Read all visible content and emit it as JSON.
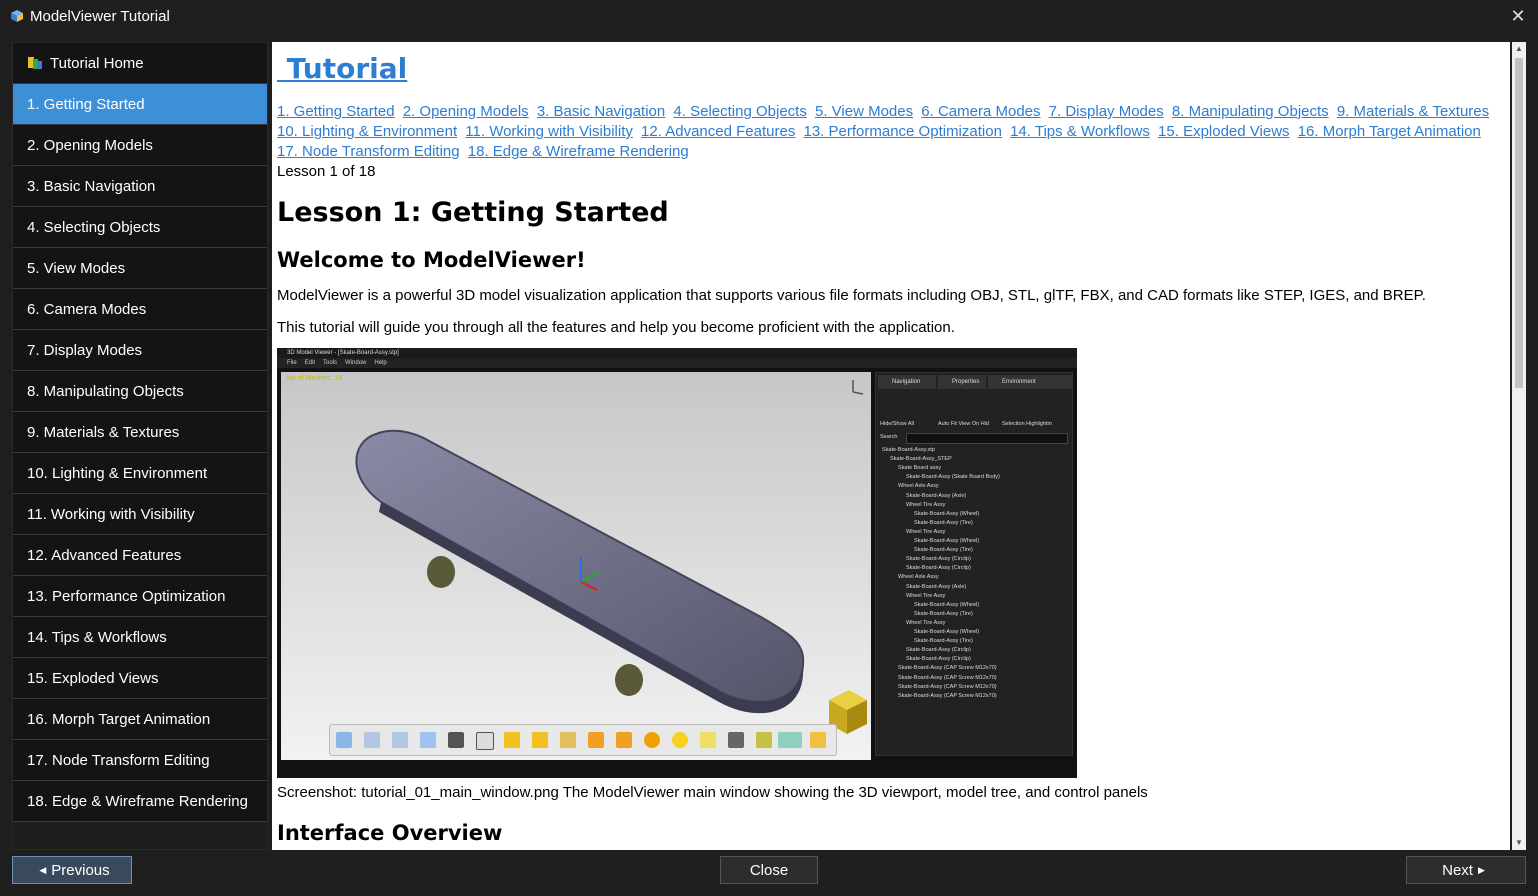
{
  "window": {
    "title": "ModelViewer Tutorial"
  },
  "sidebar": {
    "home_label": "Tutorial Home",
    "items": [
      {
        "label": "1. Getting Started",
        "active": true
      },
      {
        "label": "2. Opening Models"
      },
      {
        "label": "3. Basic Navigation"
      },
      {
        "label": "4. Selecting Objects"
      },
      {
        "label": "5. View Modes"
      },
      {
        "label": "6. Camera Modes"
      },
      {
        "label": "7. Display Modes"
      },
      {
        "label": "8. Manipulating Objects"
      },
      {
        "label": "9. Materials & Textures"
      },
      {
        "label": "10. Lighting & Environment"
      },
      {
        "label": "11. Working with Visibility"
      },
      {
        "label": "12. Advanced Features"
      },
      {
        "label": "13. Performance Optimization"
      },
      {
        "label": "14. Tips & Workflows"
      },
      {
        "label": "15. Exploded Views"
      },
      {
        "label": "16. Morph Target Animation"
      },
      {
        "label": "17. Node Transform Editing"
      },
      {
        "label": "18. Edge & Wireframe Rendering"
      }
    ]
  },
  "content": {
    "heading": "Tutorial",
    "links": [
      "1. Getting Started",
      "2. Opening Models",
      "3. Basic Navigation",
      "4. Selecting Objects",
      "5. View Modes",
      "6. Camera Modes",
      "7. Display Modes",
      "8. Manipulating Objects",
      "9. Materials & Textures",
      "10. Lighting & Environment",
      "11. Working with Visibility",
      "12. Advanced Features",
      "13. Performance Optimization",
      "14. Tips & Workflows",
      "15. Exploded Views",
      "16. Morph Target Animation",
      "17. Node Transform Editing",
      "18. Edge & Wireframe Rendering"
    ],
    "lesson_count": "Lesson 1 of 18",
    "lesson_title": "Lesson 1: Getting Started",
    "section_title": "Welcome to ModelViewer!",
    "para1": "ModelViewer is a powerful 3D model visualization application that supports various file formats including OBJ, STL, glTF, FBX, and CAD formats like STEP, IGES, and BREP.",
    "para2": "This tutorial will guide you through all the features and help you become proficient with the application.",
    "screenshot": {
      "title": "3D Model Viewer - [Skate-Board-Assy.stp]",
      "menu": [
        "File",
        "Edit",
        "Tools",
        "Window",
        "Help"
      ],
      "meshes": "No of Meshes: 19",
      "tabs": [
        "Navigation",
        "Properties",
        "Environment"
      ],
      "checks": [
        "Hide/Show All",
        "Auto Fit View On Hid",
        "Selection Highlightin"
      ],
      "search_label": "Search",
      "tree": [
        {
          "indent": 0,
          "text": "Skate-Board-Assy.stp"
        },
        {
          "indent": 1,
          "text": "Skate-Board-Assy_STEP"
        },
        {
          "indent": 2,
          "text": "Skate Board assy"
        },
        {
          "indent": 3,
          "text": "Skate-Board-Assy (Skate Board Body)"
        },
        {
          "indent": 2,
          "text": "Wheel Axle Assy"
        },
        {
          "indent": 3,
          "text": "Skate-Board-Assy (Axle)"
        },
        {
          "indent": 3,
          "text": "Wheel Tire Assy"
        },
        {
          "indent": 4,
          "text": "Skate-Board-Assy (Wheel)"
        },
        {
          "indent": 4,
          "text": "Skate-Board-Assy (Tire)"
        },
        {
          "indent": 3,
          "text": "Wheel Tire Assy"
        },
        {
          "indent": 4,
          "text": "Skate-Board-Assy (Wheel)"
        },
        {
          "indent": 4,
          "text": "Skate-Board-Assy (Tire)"
        },
        {
          "indent": 3,
          "text": "Skate-Board-Assy (Circlip)"
        },
        {
          "indent": 3,
          "text": "Skate-Board-Assy (Circlip)"
        },
        {
          "indent": 2,
          "text": "Wheel Axle Assy"
        },
        {
          "indent": 3,
          "text": "Skate-Board-Assy (Axle)"
        },
        {
          "indent": 3,
          "text": "Wheel Tire Assy"
        },
        {
          "indent": 4,
          "text": "Skate-Board-Assy (Wheel)"
        },
        {
          "indent": 4,
          "text": "Skate-Board-Assy (Tire)"
        },
        {
          "indent": 3,
          "text": "Wheel Tire Assy"
        },
        {
          "indent": 4,
          "text": "Skate-Board-Assy (Wheel)"
        },
        {
          "indent": 4,
          "text": "Skate-Board-Assy (Tire)"
        },
        {
          "indent": 3,
          "text": "Skate-Board-Assy (Circlip)"
        },
        {
          "indent": 3,
          "text": "Skate-Board-Assy (Circlip)"
        },
        {
          "indent": 2,
          "text": "Skate-Board-Assy (CAP Screw M12x70)"
        },
        {
          "indent": 2,
          "text": "Skate-Board-Assy (CAP Screw M12x70)"
        },
        {
          "indent": 2,
          "text": "Skate-Board-Assy (CAP Screw M12x70)"
        },
        {
          "indent": 2,
          "text": "Skate-Board-Assy (CAP Screw M12x70)"
        }
      ]
    },
    "caption": "Screenshot: tutorial_01_main_window.png The ModelViewer main window showing the 3D viewport, model tree, and control panels",
    "next_heading": "Interface Overview"
  },
  "footer": {
    "previous_label": "Previous",
    "close_label": "Close",
    "next_label": "Next"
  },
  "colors": {
    "accent": "#3d8fd6",
    "link": "#2d7dd2",
    "background": "#1f1f1f"
  }
}
